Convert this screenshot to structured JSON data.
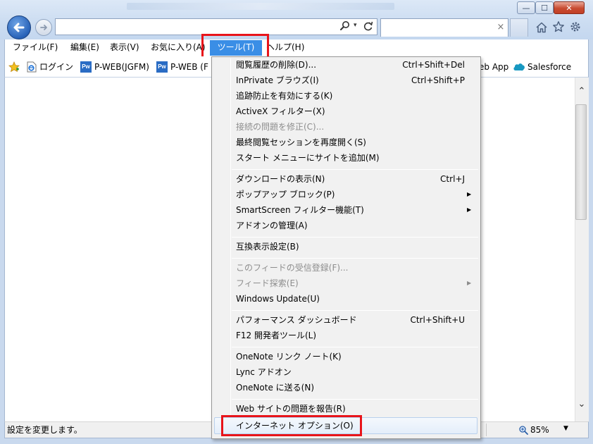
{
  "window": {
    "min_glyph": "—",
    "max_glyph": "☐",
    "close_glyph": "✕"
  },
  "address_bar": {
    "value": "",
    "tab_close_glyph": "×",
    "search_dropdown_glyph": "▾"
  },
  "menubar": {
    "items": [
      {
        "label": "ファイル(F)"
      },
      {
        "label": "編集(E)"
      },
      {
        "label": "表示(V)"
      },
      {
        "label": "お気に入り(A)"
      },
      {
        "label": "ツール(T)"
      },
      {
        "label": "ヘルプ(H)"
      }
    ]
  },
  "favorites": {
    "items": [
      {
        "label": "ログイン",
        "icon": "ie-page-icon"
      },
      {
        "label": "P-WEB(JGFM)",
        "icon": "pw-icon",
        "icon_text": "Pw"
      },
      {
        "label": "P-WEB (F",
        "icon": "pw-icon",
        "icon_text": "Pw"
      },
      {
        "label": "eb App",
        "icon": ""
      },
      {
        "label": "Salesforce",
        "icon": "salesforce-cloud-icon"
      }
    ]
  },
  "tools_menu": {
    "groups": [
      [
        {
          "label": "閲覧履歴の削除(D)...",
          "shortcut": "Ctrl+Shift+Del",
          "disabled": false
        },
        {
          "label": "InPrivate ブラウズ(I)",
          "shortcut": "Ctrl+Shift+P",
          "disabled": false
        },
        {
          "label": "追跡防止を有効にする(K)",
          "shortcut": "",
          "disabled": false
        },
        {
          "label": "ActiveX フィルター(X)",
          "shortcut": "",
          "disabled": false
        },
        {
          "label": "接続の問題を修正(C)...",
          "shortcut": "",
          "disabled": true
        },
        {
          "label": "最終閲覧セッションを再度開く(S)",
          "shortcut": "",
          "disabled": false
        },
        {
          "label": "スタート メニューにサイトを追加(M)",
          "shortcut": "",
          "disabled": false
        }
      ],
      [
        {
          "label": "ダウンロードの表示(N)",
          "shortcut": "Ctrl+J",
          "disabled": false
        },
        {
          "label": "ポップアップ ブロック(P)",
          "shortcut": "",
          "submenu": true,
          "disabled": false
        },
        {
          "label": "SmartScreen フィルター機能(T)",
          "shortcut": "",
          "submenu": true,
          "disabled": false
        },
        {
          "label": "アドオンの管理(A)",
          "shortcut": "",
          "disabled": false
        }
      ],
      [
        {
          "label": "互換表示設定(B)",
          "shortcut": "",
          "disabled": false
        }
      ],
      [
        {
          "label": "このフィードの受信登録(F)...",
          "shortcut": "",
          "disabled": true
        },
        {
          "label": "フィード探索(E)",
          "shortcut": "",
          "submenu": true,
          "disabled": true
        },
        {
          "label": "Windows Update(U)",
          "shortcut": "",
          "disabled": false
        }
      ],
      [
        {
          "label": "パフォーマンス ダッシュボード",
          "shortcut": "Ctrl+Shift+U",
          "disabled": false
        },
        {
          "label": "F12 開発者ツール(L)",
          "shortcut": "",
          "disabled": false
        }
      ],
      [
        {
          "label": "OneNote リンク ノート(K)",
          "shortcut": "",
          "disabled": false
        },
        {
          "label": "Lync アドオン",
          "shortcut": "",
          "disabled": false
        },
        {
          "label": "OneNote に送る(N)",
          "shortcut": "",
          "disabled": false
        }
      ],
      [
        {
          "label": "Web サイトの問題を報告(R)",
          "shortcut": "",
          "disabled": false
        },
        {
          "label": "インターネット オプション(O)",
          "shortcut": "",
          "disabled": false,
          "highlighted": true
        }
      ]
    ],
    "submenu_glyph": "▶"
  },
  "statusbar": {
    "text": "設定を変更します。",
    "zoom": "85%",
    "zoom_dropdown_glyph": "▼"
  },
  "scrollbar": {
    "up_glyph": "⌃",
    "down_glyph": "⌄"
  },
  "colors": {
    "highlight_frame": "#e8141a",
    "menu_selected": "#3a8ee6",
    "disabled_text": "#8d8d8d"
  }
}
